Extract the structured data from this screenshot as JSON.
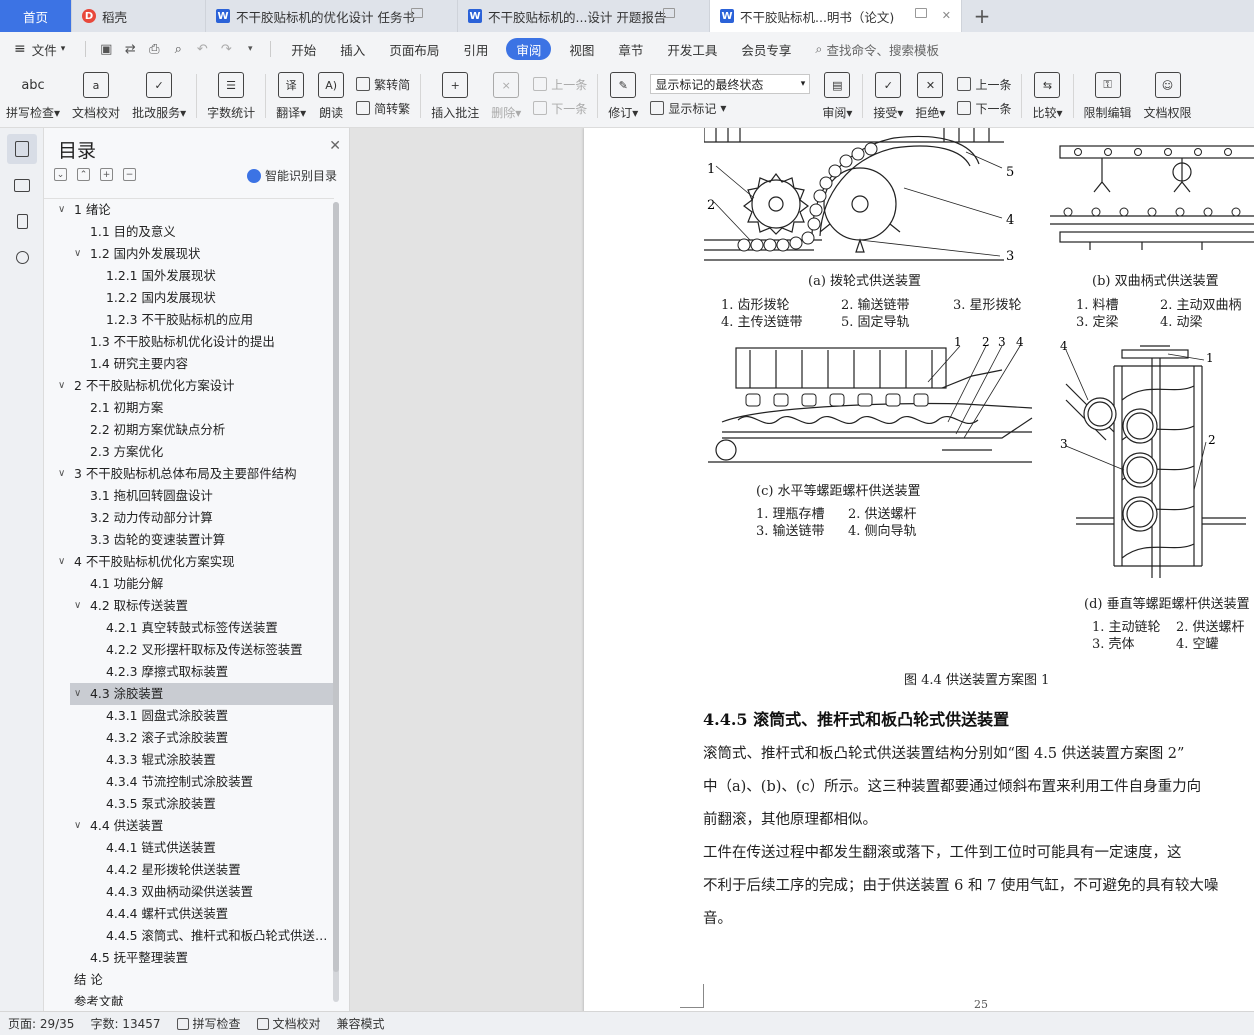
{
  "tabs": [
    {
      "label": "首页",
      "kind": "home"
    },
    {
      "label": "稻壳",
      "kind": "docer"
    },
    {
      "label": "不干胶贴标机的优化设计 任务书",
      "kind": "doc"
    },
    {
      "label": "不干胶贴标机的...设计 开题报告",
      "kind": "doc"
    },
    {
      "label": "不干胶贴标机...明书（论文)",
      "kind": "doc",
      "active": true
    }
  ],
  "menu": {
    "file": "文件",
    "items": [
      "开始",
      "插入",
      "页面布局",
      "引用",
      "审阅",
      "视图",
      "章节",
      "开发工具",
      "会员专享"
    ],
    "active": "审阅",
    "search": "查找命令、搜索模板"
  },
  "ribbon": {
    "spellcheck": "拼写检查",
    "doc_proof": "文档校对",
    "batch": "批改服务",
    "word_count": "字数统计",
    "translate": "翻译",
    "read_aloud": "朗读",
    "trad": "繁转简",
    "simp": "简转繁",
    "insert_comment": "插入批注",
    "delete": "删除",
    "prev_comment": "上一条",
    "next_comment": "下一条",
    "revise": "修订",
    "markup_select": "显示标记的最终状态",
    "show_markup": "显示标记",
    "review": "审阅",
    "accept": "接受",
    "reject": "拒绝",
    "prev_change": "上一条",
    "next_change": "下一条",
    "compare": "比较",
    "restrict": "限制编辑",
    "permission": "文档权限"
  },
  "toc": {
    "title": "目录",
    "smart": "智能识别目录",
    "items": [
      {
        "label": "1 绪论",
        "level": 1,
        "caret": "open"
      },
      {
        "label": "1.1 目的及意义",
        "level": 2
      },
      {
        "label": "1.2 国内外发展现状",
        "level": 2,
        "caret": "open"
      },
      {
        "label": "1.2.1 国外发展现状",
        "level": 3
      },
      {
        "label": "1.2.2 国内发展现状",
        "level": 3
      },
      {
        "label": "1.2.3 不干胶贴标机的应用",
        "level": 3
      },
      {
        "label": "1.3 不干胶贴标机优化设计的提出",
        "level": 2
      },
      {
        "label": "1.4 研究主要内容",
        "level": 2
      },
      {
        "label": "2 不干胶贴标机优化方案设计",
        "level": 1,
        "caret": "open"
      },
      {
        "label": "2.1  初期方案",
        "level": 2
      },
      {
        "label": "2.2  初期方案优缺点分析",
        "level": 2
      },
      {
        "label": "2.3  方案优化",
        "level": 2
      },
      {
        "label": "3 不干胶贴标机总体布局及主要部件结构",
        "level": 1,
        "caret": "open"
      },
      {
        "label": "3.1 拖机回转圆盘设计",
        "level": 2
      },
      {
        "label": "3.2 动力传动部分计算",
        "level": 2
      },
      {
        "label": "3.3 齿轮的变速装置计算",
        "level": 2
      },
      {
        "label": "4 不干胶贴标机优化方案实现",
        "level": 1,
        "caret": "open"
      },
      {
        "label": "4.1  功能分解",
        "level": 2
      },
      {
        "label": "4.2  取标传送装置",
        "level": 2,
        "caret": "open"
      },
      {
        "label": "4.2.1  真空转鼓式标签传送装置",
        "level": 3
      },
      {
        "label": "4.2.2  叉形摆杆取标及传送标签装置",
        "level": 3
      },
      {
        "label": "4.2.3  摩擦式取标装置",
        "level": 3
      },
      {
        "label": "4.3  涂胶装置",
        "level": 2,
        "caret": "open",
        "selected": true
      },
      {
        "label": "4.3.1  圆盘式涂胶装置",
        "level": 3
      },
      {
        "label": "4.3.2  滚子式涂胶装置",
        "level": 3
      },
      {
        "label": "4.3.3  辊式涂胶装置",
        "level": 3
      },
      {
        "label": "4.3.4 节流控制式涂胶装置",
        "level": 3
      },
      {
        "label": "4.3.5  泵式涂胶装置",
        "level": 3
      },
      {
        "label": "4.4  供送装置",
        "level": 2,
        "caret": "open"
      },
      {
        "label": "4.4.1  链式供送装置",
        "level": 3
      },
      {
        "label": "4.4.2  星形拨轮供送装置",
        "level": 3
      },
      {
        "label": "4.4.3  双曲柄动梁供送装置",
        "level": 3
      },
      {
        "label": "4.4.4  螺杆式供送装置",
        "level": 3
      },
      {
        "label": "4.4.5  滚筒式、推杆式和板凸轮式供送装置",
        "level": 3
      },
      {
        "label": "4.5  抚平整理装置",
        "level": 2
      },
      {
        "label": "结    论",
        "level": 1
      },
      {
        "label": "参考文献",
        "level": 1
      }
    ]
  },
  "document": {
    "figure": {
      "a": {
        "caption": "(a) 拨轮式供送装置",
        "legend": [
          "1. 齿形拨轮",
          "2. 输送链带",
          "3. 星形拨轮",
          "4. 主传送链带",
          "5. 固定导轨"
        ],
        "numbers": [
          "1",
          "2",
          "3",
          "4",
          "5"
        ]
      },
      "b": {
        "caption": "(b) 双曲柄式供送装置",
        "legend": [
          "1. 料槽",
          "2. 主动双曲柄",
          "3. 定梁",
          "4. 动梁"
        ]
      },
      "c": {
        "caption": "(c) 水平等螺距螺杆供送装置",
        "legend": [
          "1. 理瓶存槽",
          "2. 供送螺杆",
          "3. 输送链带",
          "4. 侧向导轨"
        ],
        "numbers": [
          "1",
          "2",
          "3",
          "4"
        ]
      },
      "d": {
        "caption": "(d) 垂直等螺距螺杆供送装置",
        "legend": [
          "1. 主动链轮",
          "2. 供送螺杆",
          "3. 壳体",
          "4. 空罐"
        ],
        "numbers": [
          "4",
          "1",
          "3",
          "2"
        ]
      },
      "caption": "图 4.4  供送装置方案图 1"
    },
    "heading": "4.4.5  滚筒式、推杆式和板凸轮式供送装置",
    "paragraphs": [
      "        滚筒式、推杆式和板凸轮式供送装置结构分别如“图 4.5  供送装置方案图 2”",
      "中（a)、(b)、(c）所示。这三种装置都要通过倾斜布置来利用工件自身重力向",
      "前翻滚，其他原理都相似。",
      "        工件在传送过程中都发生翻滚或落下，工件到工位时可能具有一定速度，这",
      "不利于后续工序的完成；由于供送装置 6 和 7 使用气缸，不可避免的具有较大噪",
      "音。"
    ],
    "page_number": "25"
  },
  "status": {
    "page": "页面: 29/35",
    "words": "字数: 13457",
    "spell": "拼写检查",
    "proof": "文档校对",
    "compat": "兼容模式"
  }
}
